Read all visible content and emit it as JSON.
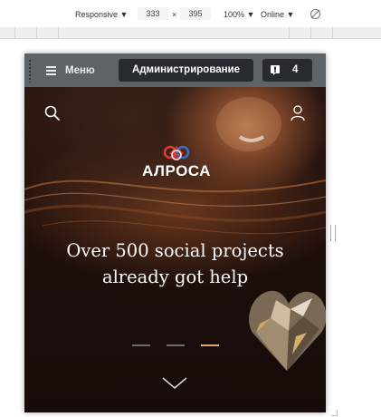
{
  "devtools": {
    "device": "Responsive",
    "width": "333",
    "times": "×",
    "height": "395",
    "zoom": "100%",
    "network": "Online",
    "dropdown_glyph": "▼"
  },
  "admin_bar": {
    "menu_label": "Меню",
    "admin_label": "Администрирование",
    "notifications_count": "4",
    "background": "#5e6368",
    "button_color": "#272b30"
  },
  "header": {
    "logo_text": "АЛРОСА",
    "icons": [
      "search-icon",
      "user-icon"
    ]
  },
  "hero": {
    "headline_line1": "Over 500 social projects",
    "headline_line2": "already got help",
    "slider": {
      "total": 3,
      "active_index": 2,
      "active_color": "#e7a56f"
    }
  }
}
